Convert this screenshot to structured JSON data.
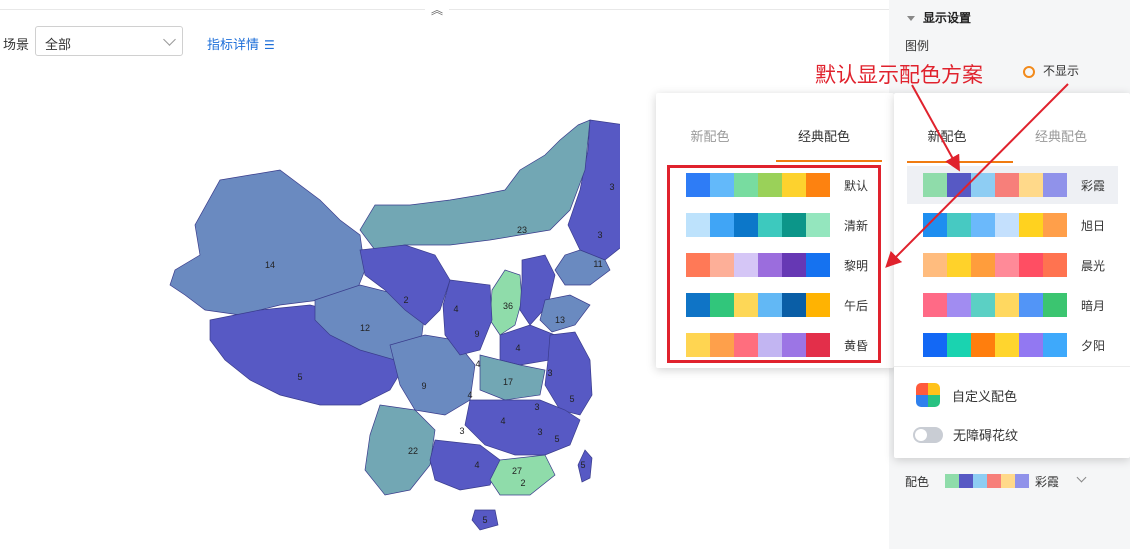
{
  "toolbar": {
    "collapse_glyph": "︽",
    "scene_label": "场景",
    "scene_value": "全部",
    "detail_link": "指标详情",
    "detail_icon": "☰"
  },
  "map": {
    "region_values": [
      "3",
      "3",
      "23",
      "11",
      "14",
      "2",
      "4",
      "9",
      "36",
      "4",
      "13",
      "12",
      "5",
      "9",
      "4",
      "3",
      "17",
      "4",
      "3",
      "4",
      "3",
      "22",
      "4",
      "3",
      "5",
      "27",
      "5",
      "2",
      "5",
      "5"
    ],
    "colors": {
      "high": "#8fdcaa",
      "mid": "#72a7b4",
      "low_mid": "#6a8ac0",
      "low": "#5759c4"
    }
  },
  "panel": {
    "section_title": "显示设置",
    "legend_label": "图例",
    "legend_hide_option": "不显示",
    "color_label": "配色",
    "current_scheme": "彩霞",
    "current_swatches": [
      "#8fdcaa",
      "#5759c4",
      "#8ecdf3",
      "#f77f7a",
      "#ffd98a",
      "#9092ea"
    ]
  },
  "popup_left": {
    "tabs": [
      "新配色",
      "经典配色"
    ],
    "active_tab": 1,
    "schemes": [
      {
        "name": "默认",
        "colors": [
          "#2e7cf6",
          "#63b9fa",
          "#78dca0",
          "#9ad159",
          "#fdd22e",
          "#fd8210"
        ]
      },
      {
        "name": "清新",
        "colors": [
          "#bde2fc",
          "#40a5f6",
          "#0c77c9",
          "#3dc9be",
          "#0c9689",
          "#94e6be"
        ]
      },
      {
        "name": "黎明",
        "colors": [
          "#ff7957",
          "#fdaf98",
          "#d5c6f6",
          "#9b6ddd",
          "#6638b4",
          "#1572f0"
        ]
      },
      {
        "name": "午后",
        "colors": [
          "#0f74c6",
          "#31c67b",
          "#fdd757",
          "#62b8f5",
          "#0a5ea6",
          "#ffb302"
        ]
      },
      {
        "name": "黄昏",
        "colors": [
          "#ffd551",
          "#fea04b",
          "#ff6e7e",
          "#c2b5f2",
          "#9c75e5",
          "#e32f4a"
        ]
      }
    ]
  },
  "popup_right": {
    "tabs": [
      "新配色",
      "经典配色"
    ],
    "active_tab": 0,
    "schemes": [
      {
        "name": "彩霞",
        "colors": [
          "#8fdcaa",
          "#5759c4",
          "#8ecdf3",
          "#f77f7a",
          "#ffd98a",
          "#9092ea"
        ]
      },
      {
        "name": "旭日",
        "colors": [
          "#1e8ef0",
          "#47c9c2",
          "#6bb9fb",
          "#c4e0fd",
          "#ffd21f",
          "#ff9f4a"
        ]
      },
      {
        "name": "晨光",
        "colors": [
          "#ffbc7e",
          "#ffd22a",
          "#ff9d3c",
          "#ff8a98",
          "#ff4e63",
          "#ff7350"
        ]
      },
      {
        "name": "暗月",
        "colors": [
          "#ff6a86",
          "#a18cf1",
          "#5bd0c4",
          "#ffd860",
          "#5295f7",
          "#3bc570"
        ]
      },
      {
        "name": "夕阳",
        "colors": [
          "#1368f5",
          "#1ad3b0",
          "#ff7e0d",
          "#ffd52e",
          "#9278f2",
          "#3ea9fb"
        ]
      }
    ],
    "custom_label": "自定义配色",
    "custom_icon_colors": [
      "#ff5a3c",
      "#ffc21a",
      "#2f80ed",
      "#27c281"
    ],
    "barrier_free_label": "无障碍花纹"
  },
  "annotation": {
    "text": "默认显示配色方案",
    "color": "#e0222d"
  }
}
